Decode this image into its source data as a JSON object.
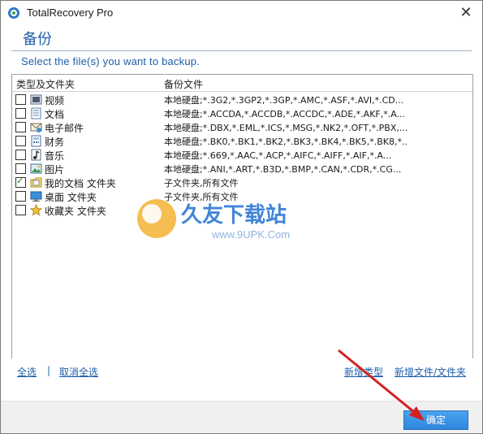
{
  "window": {
    "title": "TotalRecovery Pro",
    "close_glyph": "✕"
  },
  "page": {
    "section_title": "备份",
    "instruction": "Select the file(s) you want to backup."
  },
  "list": {
    "header_type": "类型及文件夹",
    "header_files": "备份文件",
    "rows": [
      {
        "checked": false,
        "icon": "video-icon",
        "name": "视频",
        "files": "本地硬盘;*.3G2,*.3GP2,*.3GP,*.AMC,*.ASF,*.AVI,*.CD..."
      },
      {
        "checked": false,
        "icon": "document-icon",
        "name": "文档",
        "files": "本地硬盘;*.ACCDA,*.ACCDB,*.ACCDC,*.ADE,*.AKF,*.A..."
      },
      {
        "checked": false,
        "icon": "email-icon",
        "name": "电子邮件",
        "files": "本地硬盘;*.DBX,*.EML,*.ICS,*.MSG,*.NK2,*.OFT,*.PBX,..."
      },
      {
        "checked": false,
        "icon": "finance-icon",
        "name": "财务",
        "files": "本地硬盘;*.BK0,*.BK1,*.BK2,*.BK3,*.BK4,*.BK5,*.BK8,*..."
      },
      {
        "checked": false,
        "icon": "music-icon",
        "name": "音乐",
        "files": "本地硬盘;*.669,*.AAC,*.ACP,*.AIFC,*.AIFF,*.AIF,*.A..."
      },
      {
        "checked": false,
        "icon": "picture-icon",
        "name": "图片",
        "files": "本地硬盘;*.ANI,*.ART,*.B3D,*.BMP,*.CAN,*.CDR,*.CG..."
      },
      {
        "checked": true,
        "icon": "my-documents-folder-icon",
        "name": "我的文档 文件夹",
        "files": "子文件夹,所有文件"
      },
      {
        "checked": false,
        "icon": "desktop-folder-icon",
        "name": "桌面 文件夹",
        "files": "子文件夹,所有文件"
      },
      {
        "checked": false,
        "icon": "favorites-star-icon",
        "name": "收藏夹 文件夹",
        "files": ""
      }
    ]
  },
  "links": {
    "select_all": "全选",
    "separator": "|",
    "deselect_all": "取消全选",
    "new_type": "新增类型",
    "new_file_folder": "新增文件/文件夹"
  },
  "buttons": {
    "ok": "确定"
  },
  "watermark": {
    "text_cn": "久友下载站",
    "text_url": "www.9UPK.Com"
  },
  "colors": {
    "accent_blue": "#1f5ea8",
    "ok_button": "#3a93e6",
    "arrow_red": "#d62020"
  }
}
